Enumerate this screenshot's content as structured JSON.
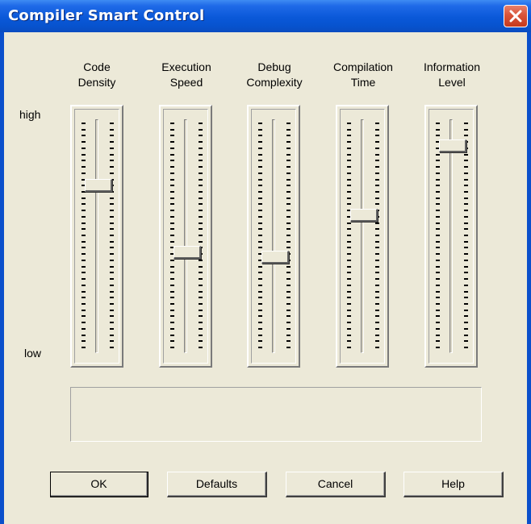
{
  "window": {
    "title": "Compiler Smart Control"
  },
  "axis": {
    "high_label": "high",
    "low_label": "low"
  },
  "sliders": [
    {
      "label_line1": "Code",
      "label_line2": "Density",
      "value": 0.72
    },
    {
      "label_line1": "Execution",
      "label_line2": "Speed",
      "value": 0.43
    },
    {
      "label_line1": "Debug",
      "label_line2": "Complexity",
      "value": 0.41
    },
    {
      "label_line1": "Compilation",
      "label_line2": "Time",
      "value": 0.59
    },
    {
      "label_line1": "Information",
      "label_line2": "Level",
      "value": 0.89
    }
  ],
  "info_text": "",
  "buttons": {
    "ok": "OK",
    "defaults": "Defaults",
    "cancel": "Cancel",
    "help": "Help"
  },
  "colors": {
    "titlebar": "#0a58d8",
    "close": "#d9543a",
    "face": "#ece9d8"
  },
  "icons": {
    "close": "close-icon"
  }
}
